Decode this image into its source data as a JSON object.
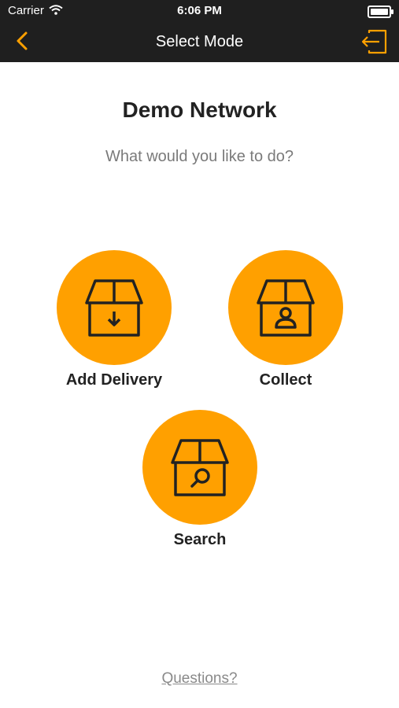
{
  "status": {
    "carrier": "Carrier",
    "time": "6:06 PM"
  },
  "nav": {
    "title": "Select Mode"
  },
  "main": {
    "title": "Demo Network",
    "subtitle": "What would you like to do?",
    "modes": [
      {
        "label": "Add Delivery",
        "icon": "box-download-icon"
      },
      {
        "label": "Collect",
        "icon": "box-person-icon"
      },
      {
        "label": "Search",
        "icon": "box-search-icon"
      }
    ],
    "questions": "Questions?"
  },
  "colors": {
    "accent": "#FFA000",
    "bar": "#1F1F1F",
    "icon": "#222222"
  }
}
